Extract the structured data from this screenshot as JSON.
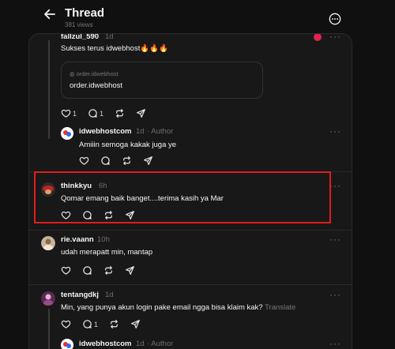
{
  "header": {
    "title": "Thread",
    "views": "381 views"
  },
  "posts": {
    "fallzul": {
      "username": "fallzul_590",
      "time": "1d",
      "text": "Sukses terus idwebhost🔥🔥🔥",
      "quote_source": "order.idwebhost",
      "quote_text": "order.idwebhost",
      "like_count": "1",
      "reply_count": "1"
    },
    "idwebhost_reply1": {
      "username": "idwebhostcom",
      "time": "1d",
      "badge": "· Author",
      "text": "Amiiin semoga kakak juga ye"
    },
    "thinkkyu": {
      "username": "thinkkyu",
      "time": "6h",
      "text": "Qomar emang baik banget....terima kasih ya Mar"
    },
    "rie": {
      "username": "rie.vaann",
      "time": "10h",
      "text": "udah merapatt min, mantap"
    },
    "tentang": {
      "username": "tentangdkj",
      "time": "1d",
      "text": "Min, yang punya akun login pake email ngga bisa klaim kak?",
      "translate": "Translate",
      "reply_count": "1"
    },
    "idwebhost_reply2": {
      "username": "idwebhostcom",
      "time": "1d",
      "badge": "· Author"
    }
  },
  "more_label": "···",
  "colors": {
    "highlight": "#e11d1d",
    "background": "#101010",
    "panel": "#181818"
  }
}
